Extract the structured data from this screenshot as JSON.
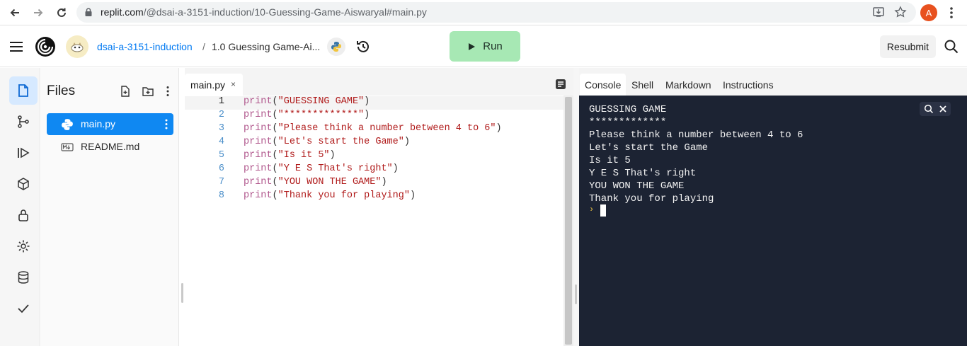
{
  "browser": {
    "url_host": "replit.com",
    "url_path": "/@dsai-a-3151-induction/10-Guessing-Game-Aiswaryal#main.py",
    "profile_initial": "A",
    "profile_color": "#e8511f"
  },
  "header": {
    "team_name": "dsai-a-3151-induction",
    "breadcrumb_separator": "/",
    "repl_name": "1.0 Guessing Game-Ai...",
    "run_label": "Run",
    "resubmit_label": "Resubmit",
    "run_color": "#a7e8b4"
  },
  "rail": {
    "icons": [
      "files-icon",
      "version-control-icon",
      "debugger-icon",
      "packages-icon",
      "secrets-icon",
      "settings-icon",
      "database-icon",
      "tests-icon"
    ],
    "active": "files-icon"
  },
  "files": {
    "title": "Files",
    "items": [
      {
        "name": "main.py",
        "icon": "python-icon",
        "selected": true
      },
      {
        "name": "README.md",
        "icon": "markdown-icon",
        "selected": false
      }
    ],
    "selected_color": "#0f88f2"
  },
  "editor": {
    "tab_name": "main.py",
    "tab_close": "×",
    "current_line": 1,
    "lines": [
      {
        "n": "1",
        "fn": "print",
        "open": "(",
        "str": "\"GUESSING GAME\"",
        "close": ")"
      },
      {
        "n": "2",
        "fn": "print",
        "open": "(",
        "str": "\"*************\"",
        "close": ")"
      },
      {
        "n": "3",
        "fn": "print",
        "open": "(",
        "str": "\"Please think a number between 4 to 6\"",
        "close": ")"
      },
      {
        "n": "4",
        "fn": "print",
        "open": "(",
        "str": "\"Let's start the Game\"",
        "close": ")"
      },
      {
        "n": "5",
        "fn": "print",
        "open": "(",
        "str": "\"Is it 5\"",
        "close": ")"
      },
      {
        "n": "6",
        "fn": "print",
        "open": "(",
        "str": "\"Y E S That's right\"",
        "close": ")"
      },
      {
        "n": "7",
        "fn": "print",
        "open": "(",
        "str": "\"YOU WON THE GAME\"",
        "close": ")"
      },
      {
        "n": "8",
        "fn": "print",
        "open": "(",
        "str": "\"Thank you for playing\"",
        "close": ")"
      }
    ]
  },
  "console": {
    "tabs": [
      "Console",
      "Shell",
      "Markdown",
      "Instructions"
    ],
    "active_tab": "Console",
    "output": [
      "GUESSING GAME",
      "*************",
      "Please think a number between 4 to 6",
      "Let's start the Game",
      "Is it 5",
      "Y E S That's right",
      "YOU WON THE GAME",
      "Thank you for playing"
    ],
    "prompt": "›",
    "background": "#1c2333"
  }
}
